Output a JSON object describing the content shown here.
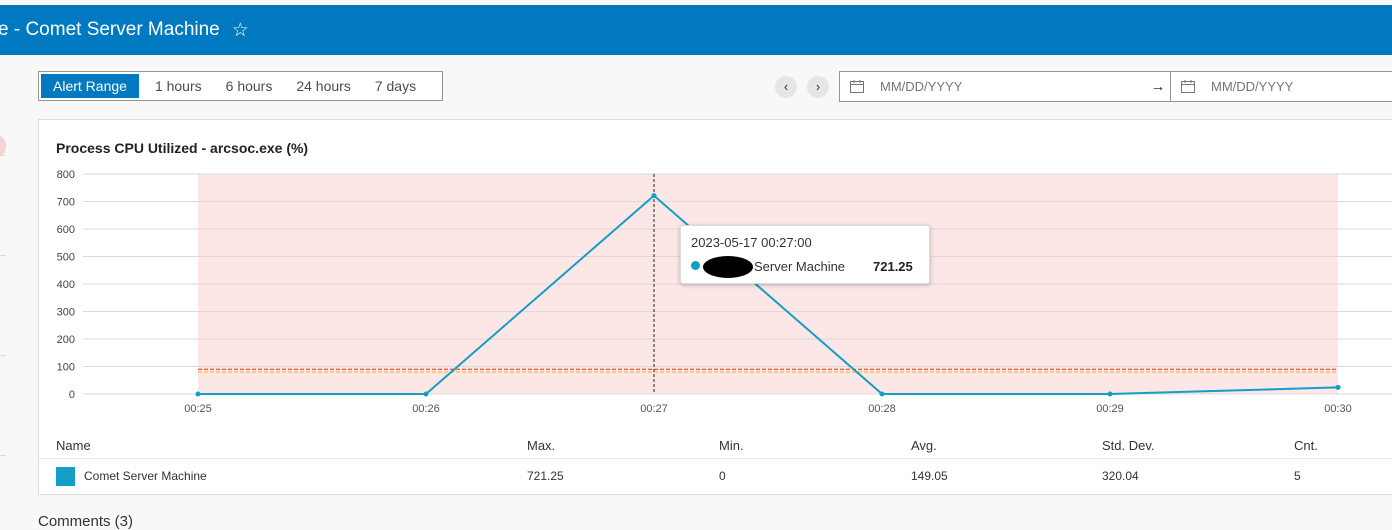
{
  "header": {
    "title": "e - Comet Server Machine"
  },
  "range": {
    "buttons": [
      "Alert Range",
      "1 hours",
      "6 hours",
      "24 hours",
      "7 days"
    ],
    "active": "Alert Range"
  },
  "nav": {
    "prev": "‹",
    "next": "›"
  },
  "date": {
    "start_placeholder": "MM/DD/YYYY",
    "end_placeholder": "MM/DD/YYYY",
    "separator": "→"
  },
  "chart_data": {
    "type": "line",
    "title": "Process CPU Utilized - arcsoc.exe (%)",
    "x": [
      "00:25",
      "00:26",
      "00:27",
      "00:28",
      "00:29",
      "00:30"
    ],
    "series": [
      {
        "name": "Server Machine",
        "values": [
          0,
          0,
          721.25,
          0,
          0,
          24
        ]
      }
    ],
    "ylim": [
      0,
      800
    ],
    "yticks": [
      0,
      100,
      200,
      300,
      400,
      500,
      600,
      700,
      800
    ],
    "threshold_lines": [
      90,
      80
    ],
    "grid": true,
    "alert_band": true,
    "colors": {
      "line": "#139ec8",
      "alert_band": "#fce7e6",
      "threshold_red": "#d83020",
      "threshold_yellow": "#e8b800"
    },
    "crosshair_x": "00:27"
  },
  "tooltip": {
    "time": "2023-05-17 00:27:00",
    "series": "Server Machine",
    "value": "721.25"
  },
  "stats": {
    "headers": {
      "name": "Name",
      "max": "Max.",
      "min": "Min.",
      "avg": "Avg.",
      "std": "Std. Dev.",
      "cnt": "Cnt."
    },
    "row": {
      "name": "Comet Server Machine",
      "max": "721.25",
      "min": "0",
      "avg": "149.05",
      "std": "320.04",
      "cnt": "5"
    }
  },
  "comments": {
    "label": "Comments (3)"
  }
}
